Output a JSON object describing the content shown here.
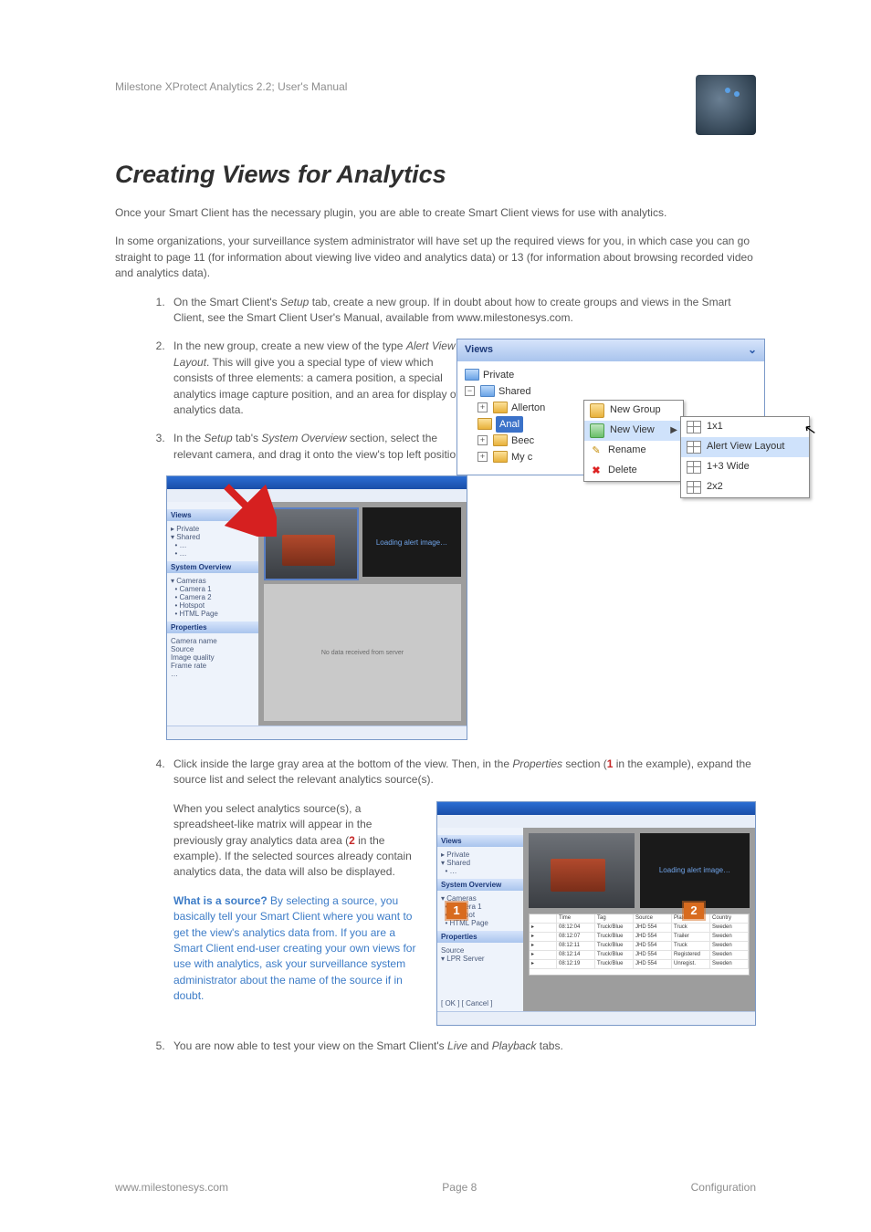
{
  "doc": {
    "header_title": "Milestone XProtect Analytics 2.2; User's Manual",
    "h1": "Creating Views for Analytics",
    "intro1": "Once your Smart Client has the necessary plugin, you are able to create Smart Client views for use with analytics.",
    "intro2": "In some organizations, your surveillance system administrator will have set up the required views for you, in which case you can go straight to page 11 (for information about viewing live video and analytics data) or 13 (for information about  browsing recorded video and analytics data).",
    "step1_a": "On the Smart Client's ",
    "step1_b": "Setup",
    "step1_c": " tab, create a new group. If in doubt about how to create groups and views in the Smart Client, see the Smart Client User's Manual, available from www.milestonesys.com.",
    "step2_a": "In the new group, create a new view of the type ",
    "step2_b": "Alert View Layout",
    "step2_c": ". This will give you a special type of view which consists of three elements: a camera position, a special analytics image capture position, and an area for display of analytics data.",
    "step3_a": "In the ",
    "step3_b": "Setup",
    "step3_c": " tab's ",
    "step3_d": "System Overview",
    "step3_e": " section, select the relevant camera, and drag it onto the view's top left position.",
    "step4_a": "Click inside the large gray area at the bottom of the view. Then, in the ",
    "step4_b": "Properties",
    "step4_c": " section (",
    "step4_d": "1",
    "step4_e": " in the example), expand the source list and select the relevant analytics source(s).",
    "step4_para_a": "When you select analytics source(s), a spreadsheet-like matrix will appear in the previously gray analytics data area (",
    "step4_para_b": "2",
    "step4_para_c": " in the example). If the selected sources already contain analytics data, the data will also be displayed.",
    "tip_lead": "What is a source?",
    "tip_body": " By selecting a source, you basically tell your Smart Client where you want to get the view's analytics data from. If you are a Smart Client end-user creating your own views for use with analytics, ask your surveillance system administrator about the name of the source if in doubt.",
    "step5_a": "You are now able to test your view on the Smart Client's ",
    "step5_b": "Live",
    "step5_c": " and ",
    "step5_d": "Playback",
    "step5_e": " tabs.",
    "footer_left": "www.milestonesys.com",
    "footer_center": "Page 8",
    "footer_right": "Configuration"
  },
  "views_panel": {
    "title": "Views",
    "private": "Private",
    "shared": "Shared",
    "allerton": "Allerton",
    "anal": "Anal",
    "beec": "Beec",
    "myc": "My c",
    "ctx_new_group": "New Group",
    "ctx_new_view": "New View",
    "ctx_rename": "Rename",
    "ctx_delete": "Delete",
    "sub_1x1": "1x1",
    "sub_alert": "Alert View Layout",
    "sub_13wide": "1+3 Wide",
    "sub_2x2": "2x2"
  },
  "shot_a": {
    "alert_text": "Loading alert image…",
    "grey_text": "No data received from server",
    "sec_views": "Views",
    "sec_sys": "System Overview",
    "sec_props": "Properties"
  },
  "shot_b": {
    "alert_text": "Loading alert image…",
    "callout1": "1",
    "callout2": "2",
    "sec_views": "Views",
    "sec_sys": "System Overview",
    "sec_props": "Properties"
  }
}
